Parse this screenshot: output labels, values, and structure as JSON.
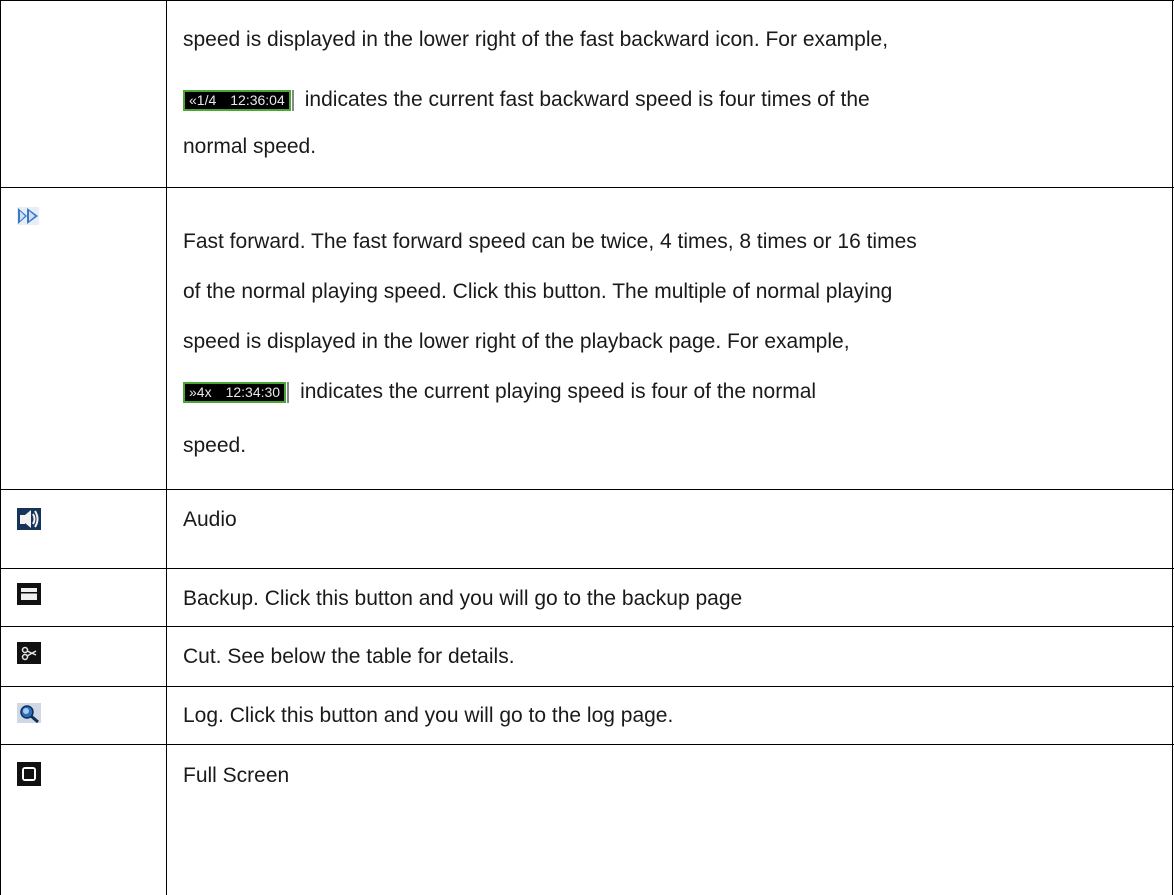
{
  "rows": [
    {
      "icon": "",
      "lines": [
        "speed is displayed in the lower right of the fast backward icon. For example,",
        "indicates the current fast backward speed is four times of the",
        "normal speed."
      ],
      "ticker": {
        "tag": "«1/4",
        "time": "12:36:04"
      }
    },
    {
      "icon": "fast-forward-icon",
      "lines": [
        "Fast forward. The fast forward speed can be twice, 4 times, 8 times or 16 times",
        "of the normal playing speed. Click this button. The multiple of normal playing",
        "speed is displayed in the lower right of the playback page. For example,",
        "indicates the current playing speed is four of the normal",
        "speed."
      ],
      "ticker": {
        "tag": "»4x",
        "time": "12:34:30"
      }
    },
    {
      "icon": "audio-icon",
      "lines": [
        "Audio"
      ]
    },
    {
      "icon": "backup-icon",
      "lines": [
        "Backup. Click this button and you will go to the backup page"
      ]
    },
    {
      "icon": "cut-icon",
      "lines": [
        "Cut. See below the table for details."
      ]
    },
    {
      "icon": "log-icon",
      "lines": [
        "Log. Click this button and you will go to the log page."
      ]
    },
    {
      "icon": "full-screen-icon",
      "lines": [
        "Full Screen"
      ]
    }
  ],
  "colors": {
    "border": "#000000",
    "ticker_frame": "#4aa832",
    "icon_dark": "#111111",
    "icon_blue": "#2c6fb8"
  }
}
